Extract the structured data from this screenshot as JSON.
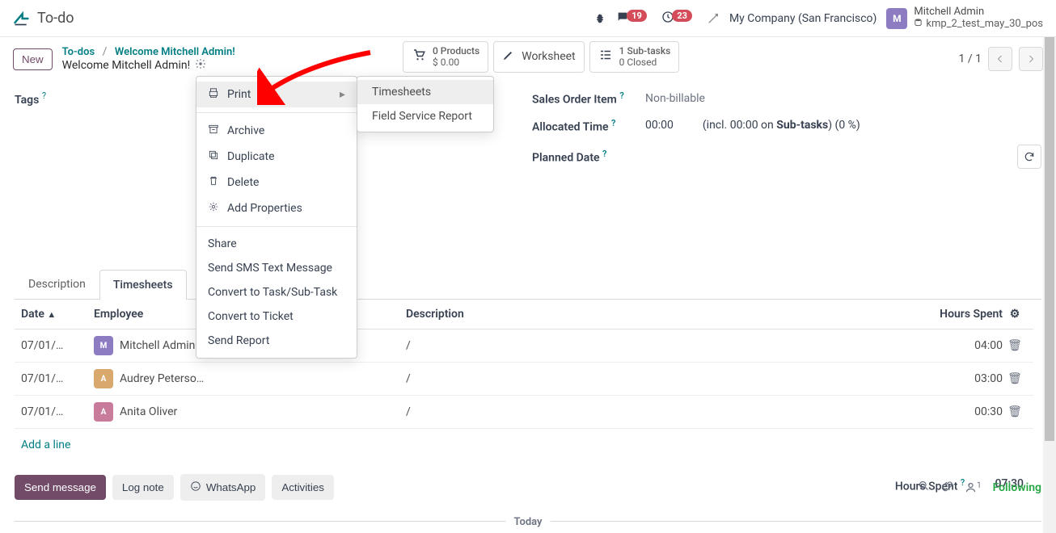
{
  "topbar": {
    "app_title": "To-do",
    "msg_badge": "19",
    "clock_badge": "23",
    "company": "My Company (San Francisco)",
    "user_name": "Mitchell Admin",
    "db_name": "kmp_2_test_may_30_pos"
  },
  "header": {
    "new_label": "New",
    "crumb1": "To-dos",
    "crumb2": "Welcome Mitchell Admin!",
    "title": "Welcome Mitchell Admin!",
    "pager": "1 / 1"
  },
  "stats": {
    "products_top": "0 Products",
    "products_bottom": "$ 0.00",
    "worksheet": "Worksheet",
    "subtasks_top": "1 Sub-tasks",
    "subtasks_bottom": "0 Closed"
  },
  "left": {
    "tags_label": "Tags"
  },
  "right": {
    "sales_label": "Sales Order Item",
    "sales_value": "Non-billable",
    "alloc_label": "Allocated Time",
    "alloc_value": "00:00",
    "alloc_extra1": "(incl. 00:00 on ",
    "alloc_extra_bold": "Sub-tasks",
    "alloc_extra2": ") (0 %)",
    "planned_label": "Planned Date"
  },
  "tabs": {
    "desc": "Description",
    "timesheets": "Timesheets"
  },
  "table": {
    "hdr_date": "Date",
    "hdr_employee": "Employee",
    "hdr_description": "Description",
    "hdr_hours": "Hours Spent",
    "rows": [
      {
        "date": "07/01/…",
        "employee": "Mitchell Admin",
        "desc": "/",
        "hours": "04:00"
      },
      {
        "date": "07/01/…",
        "employee": "Audrey Peterso…",
        "desc": "/",
        "hours": "03:00"
      },
      {
        "date": "07/01/…",
        "employee": "Anita Oliver",
        "desc": "/",
        "hours": "00:30"
      }
    ],
    "add_line": "Add a line",
    "total_label": "Hours Spent",
    "total_suffix": ":",
    "total_value": "07:30"
  },
  "dropdown": {
    "print": "Print",
    "archive": "Archive",
    "duplicate": "Duplicate",
    "delete": "Delete",
    "add_props": "Add Properties",
    "share": "Share",
    "sms": "Send SMS Text Message",
    "convert_task": "Convert to Task/Sub-Task",
    "convert_ticket": "Convert to Ticket",
    "send_report": "Send Report"
  },
  "submenu": {
    "timesheets": "Timesheets",
    "field_service": "Field Service Report"
  },
  "footer": {
    "send_message": "Send message",
    "log_note": "Log note",
    "whatsapp": "WhatsApp",
    "activities": "Activities",
    "following": "Following",
    "follower_count": "1",
    "today": "Today"
  }
}
